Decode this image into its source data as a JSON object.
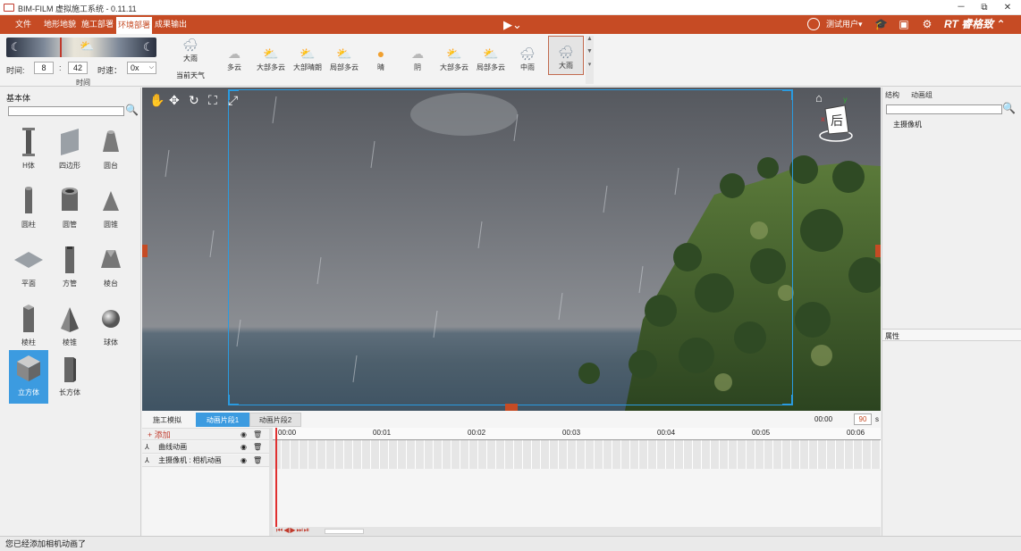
{
  "app": {
    "title": "BIM-FILM 虚拟施工系统 - 0.11.11"
  },
  "window_controls": {
    "minimize": "－",
    "restore": "⧉",
    "close": "✕"
  },
  "menu": {
    "items": [
      "文件",
      "地形地貌",
      "施工部署",
      "环境部署",
      "成果输出"
    ],
    "active_index": 3,
    "play_icon": "▶⌄",
    "user_label": "测试用户▾",
    "brand": "RT 睿格致 ⌃"
  },
  "time": {
    "time_label": "时间:",
    "hour": "8",
    "minute": "42",
    "colon": ":",
    "speed_label": "时速：",
    "speed_value": "0x",
    "section_label": "时间"
  },
  "weather": {
    "current_label": "大雨",
    "current_title": "当前天气",
    "items": [
      {
        "label": "多云",
        "icon": "cloud-icon"
      },
      {
        "label": "大部多云",
        "icon": "sun-cloud-icon"
      },
      {
        "label": "大部晴朗",
        "icon": "sun-cloud-icon"
      },
      {
        "label": "局部多云",
        "icon": "sun-cloud-icon"
      },
      {
        "label": "晴",
        "icon": "sun-icon"
      },
      {
        "label": "阴",
        "icon": "cloud-icon"
      },
      {
        "label": "大部多云",
        "icon": "sun-cloud-icon"
      },
      {
        "label": "局部多云",
        "icon": "sun-cloud-icon"
      },
      {
        "label": "中雨",
        "icon": "rain-icon"
      },
      {
        "label": "大雨",
        "icon": "heavy-rain-icon"
      }
    ],
    "selected_index": 9
  },
  "left_panel": {
    "title": "基本体",
    "primitives": [
      "H体",
      "四边形",
      "圆台",
      "圆柱",
      "圆管",
      "圆锥",
      "平面",
      "方管",
      "棱台",
      "棱柱",
      "棱锥",
      "球体",
      "立方体",
      "长方体"
    ],
    "selected_index": 12
  },
  "right_panel": {
    "tabs": [
      "结构",
      "动画组"
    ],
    "tree_items": [
      "主摄像机"
    ],
    "properties_title": "属性"
  },
  "timeline": {
    "tabs": [
      "施工模拟",
      "动画片段1",
      "动画片段2"
    ],
    "active_tab": 1,
    "current_time": "00:00",
    "duration": "90",
    "duration_unit": "s",
    "add_label": "+ 添加",
    "tracks": [
      "曲线动画",
      "主摄像机 : 相机动画"
    ],
    "ruler": [
      "00:00",
      "00:01",
      "00:02",
      "00:03",
      "00:04",
      "00:05",
      "00:06"
    ],
    "controls": "⏮◀▶⏭⏯"
  },
  "status": {
    "message": "您已经添加相机动画了"
  },
  "colors": {
    "accent": "#c64b24",
    "selection": "#3c9be0",
    "frame": "#2a9be0"
  }
}
